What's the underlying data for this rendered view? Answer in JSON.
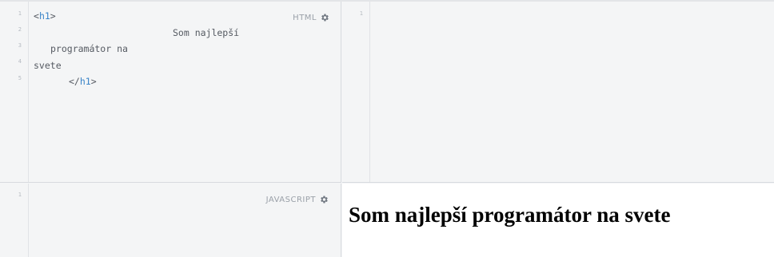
{
  "panels": {
    "html": {
      "label": "HTML",
      "line_numbers": [
        "1",
        "2",
        "3",
        "4",
        "5"
      ],
      "lines": [
        {
          "text_open": "<",
          "tag": "h1",
          "text_close": ">"
        },
        {
          "text": "Som najlepší"
        },
        {
          "text": "programátor na"
        },
        {
          "text": "svete"
        },
        {
          "text_open": "</",
          "tag": "h1",
          "text_close": ">"
        }
      ]
    },
    "css": {
      "line_numbers": [
        "1"
      ]
    },
    "javascript": {
      "label": "JAVASCRIPT",
      "line_numbers": [
        "1"
      ]
    },
    "output": {
      "heading": "Som najlepší programátor na svete"
    }
  },
  "icons": {
    "html_settings": "gear-icon",
    "js_settings": "gear-icon"
  },
  "colors": {
    "editor_bg": "#f4f5f6",
    "tag": "#3a84c8",
    "text": "#555a62",
    "line_number": "#b6bbc2",
    "label": "#9aa0a8"
  }
}
